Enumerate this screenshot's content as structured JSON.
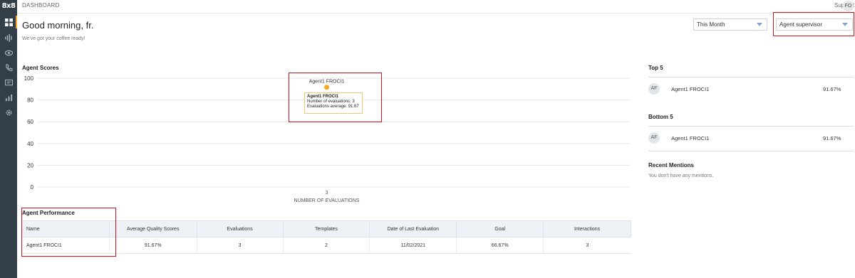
{
  "app": {
    "logo": "8x8",
    "breadcrumb": "DASHBOARD",
    "support": "Support",
    "user_initials": "FO"
  },
  "greeting": {
    "title": "Good morning, fr.",
    "subtitle": "We've got your coffee ready!"
  },
  "filters": {
    "period": "This Month",
    "role": "Agent supervisor"
  },
  "nav_icons": [
    "dashboard-icon",
    "waveform-icon",
    "eye-icon",
    "phone-icon",
    "message-icon",
    "bar-chart-icon",
    "gear-icon"
  ],
  "agent_scores": {
    "title": "Agent Scores",
    "point_label": "Agent1 FROCI1",
    "tooltip": {
      "name": "Agent1 FROCI1",
      "evaluations": "Number of evaluations: 3",
      "average": "Evaluations average: 91.67"
    }
  },
  "chart_data": {
    "type": "scatter",
    "xlabel": "NUMBER OF EVALUATIONS",
    "ylabel": "",
    "ylim": [
      0,
      100
    ],
    "yticks": [
      "100",
      "80",
      "60",
      "40",
      "20",
      "0"
    ],
    "xticks": [
      "3"
    ],
    "x": [
      3
    ],
    "y": [
      91.67
    ],
    "point_color": "#f5a623"
  },
  "performance": {
    "title": "Agent Performance",
    "columns": [
      "Name",
      "Average Quality Scores",
      "Evaluations",
      "Templates",
      "Date of Last Evaluation",
      "Goal",
      "Interactions"
    ],
    "rows": [
      [
        "Agent1 FROCI1",
        "91.67%",
        "3",
        "2",
        "11/02/2021",
        "66.67%",
        "3"
      ]
    ]
  },
  "top5": {
    "title": "Top 5",
    "items": [
      {
        "initials": "AF",
        "name": "Agent1 FROCI1",
        "score": "91.67%"
      }
    ]
  },
  "bottom5": {
    "title": "Bottom 5",
    "items": [
      {
        "initials": "AF",
        "name": "Agent1 FROCI1",
        "score": "91.67%"
      }
    ]
  },
  "mentions": {
    "title": "Recent Mentions",
    "empty": "You don't have any mentions."
  },
  "colors": {
    "sidebar": "#323e48",
    "highlight": "#d7121b",
    "accent": "#f5a623"
  }
}
